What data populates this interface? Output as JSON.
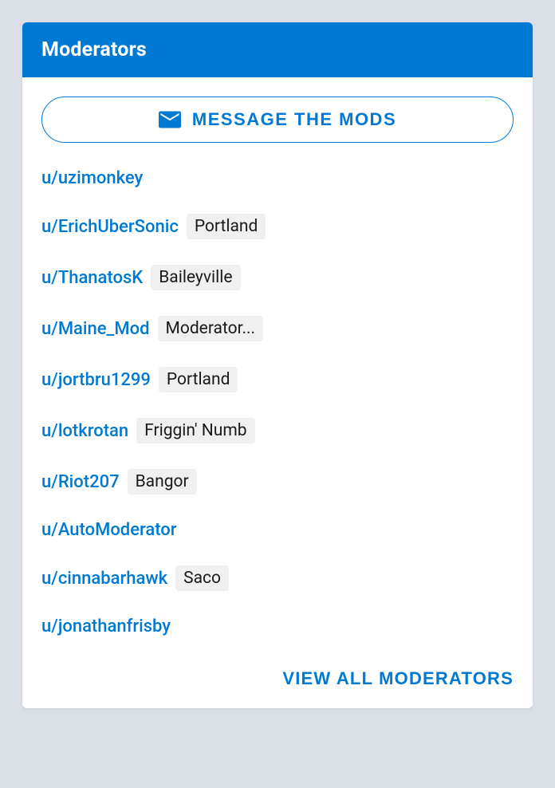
{
  "header": {
    "title": "Moderators"
  },
  "message_button": {
    "label": "MESSAGE THE MODS",
    "icon": "envelope-icon"
  },
  "moderators": [
    {
      "username": "u/uzimonkey",
      "flair": null
    },
    {
      "username": "u/ErichUberSonic",
      "flair": "Portland"
    },
    {
      "username": "u/ThanatosK",
      "flair": "Baileyville"
    },
    {
      "username": "u/Maine_Mod",
      "flair": "Moderator..."
    },
    {
      "username": "u/jortbru1299",
      "flair": "Portland"
    },
    {
      "username": "u/lotkrotan",
      "flair": "Friggin' Numb"
    },
    {
      "username": "u/Riot207",
      "flair": "Bangor"
    },
    {
      "username": "u/AutoModerator",
      "flair": null
    },
    {
      "username": "u/cinnabarhawk",
      "flair": "Saco"
    },
    {
      "username": "u/jonathanfrisby",
      "flair": null
    }
  ],
  "footer": {
    "view_all_label": "VIEW ALL MODERATORS"
  },
  "colors": {
    "brand": "#0079d3",
    "flair_bg": "#f0f0f0",
    "text": "#1a1a1b",
    "page_bg": "#dae0e6"
  }
}
